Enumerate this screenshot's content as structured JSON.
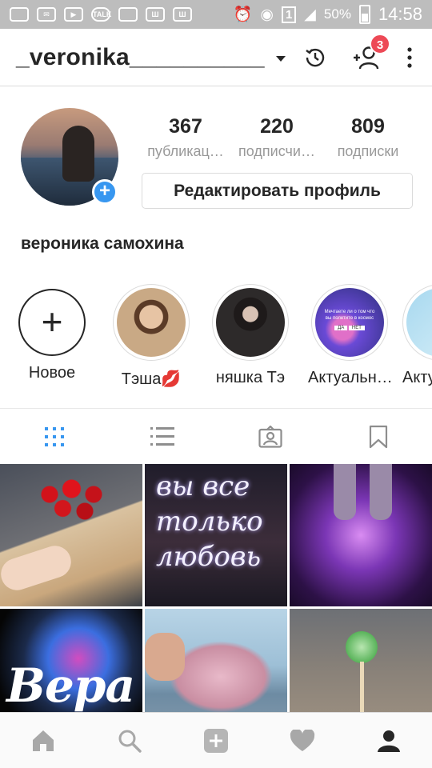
{
  "status_bar": {
    "icons": [
      "message-icon",
      "mail-icon",
      "youtube-icon",
      "talk-icon",
      "gallery-icon",
      "w-icon",
      "w-icon",
      "alarm-icon",
      "wifi-icon",
      "sim-icon",
      "signal-icon"
    ],
    "battery": "50%",
    "time": "14:58"
  },
  "header": {
    "username": "_veronika__________",
    "notification_count": "3"
  },
  "profile": {
    "stats": [
      {
        "value": "367",
        "label": "публикац…"
      },
      {
        "value": "220",
        "label": "подписчи…"
      },
      {
        "value": "809",
        "label": "подписки"
      }
    ],
    "edit_button": "Редактировать профиль",
    "full_name": "вероника самохина"
  },
  "highlights": [
    {
      "label": "Новое"
    },
    {
      "label": "Тэша💋"
    },
    {
      "label": "няшка Тэ"
    },
    {
      "label": "Актуальн…"
    },
    {
      "label": "Акту"
    }
  ],
  "highlight_story_text": {
    "line1": "Мечтаете ли о том что",
    "line2": "вы полетите в космос",
    "yes": "ДА",
    "no": "НЕТ"
  },
  "posts": [
    {
      "caption": ""
    },
    {
      "caption": "вы все только любовь"
    },
    {
      "caption": ""
    },
    {
      "caption": "Вера"
    },
    {
      "caption": ""
    },
    {
      "caption": ""
    }
  ],
  "colors": {
    "accent": "#3897f0",
    "badge": "#ed4956",
    "text": "#262626",
    "muted": "#999999"
  }
}
